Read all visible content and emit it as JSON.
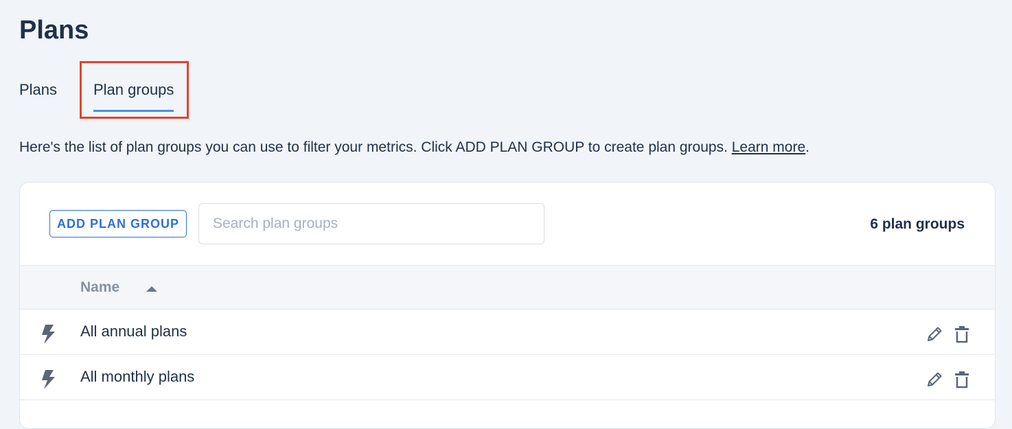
{
  "page": {
    "title": "Plans"
  },
  "tabs": [
    {
      "label": "Plans",
      "active": false
    },
    {
      "label": "Plan groups",
      "active": true
    }
  ],
  "description": {
    "text": "Here's the list of plan groups you can use to filter your metrics. Click ADD PLAN GROUP to create plan groups. ",
    "link_text": "Learn more",
    "suffix": "."
  },
  "toolbar": {
    "add_label": "ADD PLAN GROUP",
    "search_placeholder": "Search plan groups",
    "search_value": "",
    "count_label": "6 plan groups"
  },
  "table": {
    "columns": [
      {
        "label": "Name",
        "sort": "ascending"
      }
    ],
    "rows": [
      {
        "name": "All annual plans",
        "icon": "bolt-icon"
      },
      {
        "name": "All monthly plans",
        "icon": "bolt-icon"
      }
    ],
    "row_actions": [
      "pencil-icon",
      "trash-icon"
    ]
  },
  "colors": {
    "accent": "#2e6fd8",
    "tab_underline": "#4a90e2",
    "highlight": "#e0432d",
    "text": "#1f3148",
    "muted": "#8691a2"
  }
}
